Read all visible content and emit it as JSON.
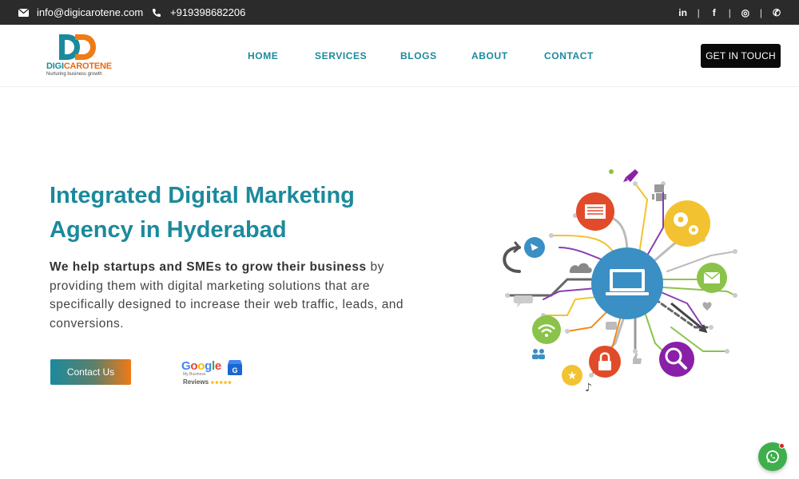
{
  "topbar": {
    "email": "info@digicarotene.com",
    "phone": "+919398682206",
    "email_icon": "envelope-icon",
    "phone_icon": "phone-icon",
    "social": [
      {
        "name": "linkedin-icon",
        "glyph": "in"
      },
      {
        "name": "facebook-icon",
        "glyph": "f"
      },
      {
        "name": "instagram-icon",
        "glyph": "◎"
      },
      {
        "name": "whatsapp-icon",
        "glyph": "✆"
      }
    ],
    "separator": "|"
  },
  "header": {
    "logo_word_part1": "DIGI",
    "logo_word_part2": "CAROTENE",
    "logo_tagline": "Nurturing business growth",
    "nav": [
      "HOME",
      "SERVICES",
      "BLOGS",
      "ABOUT",
      "CONTACT"
    ],
    "cta": "GET IN TOUCH"
  },
  "hero": {
    "title_line1": "Integrated Digital Marketing",
    "title_line2": "Agency in Hyderabad",
    "desc_bold": "We help startups and SMEs to grow their business",
    "desc_rest": " by providing them with digital marketing solutions that are specifically designed to increase their web traffic, leads, and conversions.",
    "contact_button": "Contact Us",
    "google": {
      "word": "Google",
      "sub": "My Business",
      "reviews": "Reviews",
      "stars": "★★★★★"
    }
  },
  "colors": {
    "accent": "#1b8a9c",
    "orange": "#f07a16",
    "dark": "#2b2b2b",
    "whatsapp": "#3fae4c"
  }
}
